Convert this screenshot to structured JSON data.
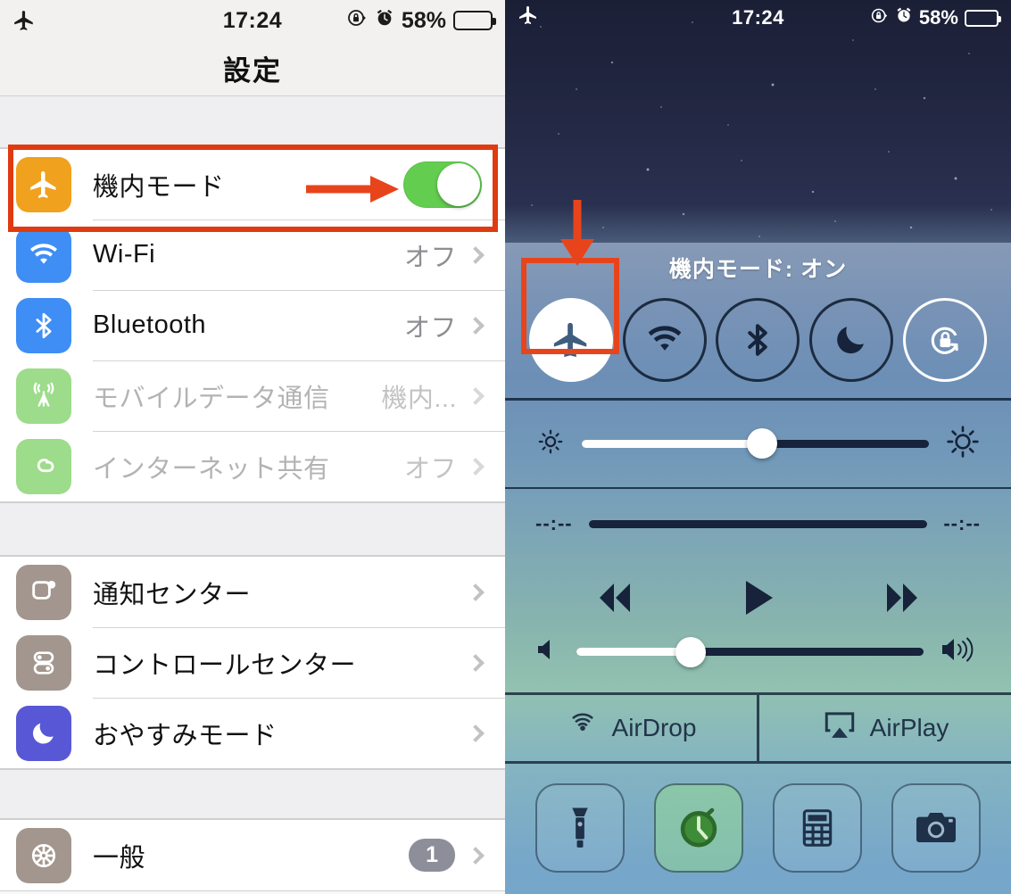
{
  "status_bar": {
    "airplane_icon": "airplane-icon",
    "time": "17:24",
    "rotation_lock_icon": "rotation-lock-icon",
    "alarm_icon": "alarm-icon",
    "battery_percent": "58%",
    "battery_level": 58
  },
  "settings": {
    "nav_title": "設定",
    "group1": [
      {
        "icon": "airplane-icon",
        "label": "機内モード",
        "control": "toggle",
        "toggle_on": true,
        "dim": false
      },
      {
        "icon": "wifi-icon",
        "label": "Wi-Fi",
        "value": "オフ",
        "control": "chevron",
        "dim": false
      },
      {
        "icon": "bluetooth-icon",
        "label": "Bluetooth",
        "value": "オフ",
        "control": "chevron",
        "dim": false
      },
      {
        "icon": "cellular-icon",
        "label": "モバイルデータ通信",
        "value": "機内...",
        "control": "chevron",
        "dim": true
      },
      {
        "icon": "tethering-icon",
        "label": "インターネット共有",
        "value": "オフ",
        "control": "chevron",
        "dim": true
      }
    ],
    "group2": [
      {
        "icon": "notification-center-icon",
        "label": "通知センター",
        "value": "",
        "control": "chevron",
        "dim": false
      },
      {
        "icon": "control-center-icon",
        "label": "コントロールセンター",
        "value": "",
        "control": "chevron",
        "dim": false
      },
      {
        "icon": "do-not-disturb-icon",
        "label": "おやすみモード",
        "value": "",
        "control": "chevron",
        "dim": false
      }
    ],
    "group3": [
      {
        "icon": "general-gear-icon",
        "label": "一般",
        "badge": "1",
        "control": "chevron",
        "dim": false
      }
    ]
  },
  "control_center": {
    "title": "機内モード: オン",
    "toggles": [
      {
        "name": "airplane-mode-toggle",
        "icon": "airplane-icon",
        "active": true
      },
      {
        "name": "wifi-toggle",
        "icon": "wifi-icon",
        "active": false
      },
      {
        "name": "bluetooth-toggle",
        "icon": "bluetooth-icon",
        "active": false
      },
      {
        "name": "do-not-disturb-toggle",
        "icon": "moon-icon",
        "active": false
      },
      {
        "name": "rotation-lock-toggle",
        "icon": "rotation-lock-icon",
        "active": false
      }
    ],
    "brightness": {
      "value_percent": 52,
      "low_icon": "brightness-low-icon",
      "high_icon": "brightness-high-icon"
    },
    "scrubber": {
      "elapsed": "--:--",
      "remaining": "--:--",
      "value_percent": 0
    },
    "media": {
      "rewind": "rewind-icon",
      "play": "play-icon",
      "forward": "forward-icon"
    },
    "volume": {
      "value_percent": 33,
      "low_icon": "volume-low-icon",
      "high_icon": "volume-high-icon"
    },
    "airdrop_label": "AirDrop",
    "airplay_label": "AirPlay",
    "shortcuts": [
      {
        "name": "flashlight-shortcut",
        "icon": "flashlight-icon",
        "active": false
      },
      {
        "name": "timer-shortcut",
        "icon": "timer-icon",
        "active": true
      },
      {
        "name": "calculator-shortcut",
        "icon": "calculator-icon",
        "active": false
      },
      {
        "name": "camera-shortcut",
        "icon": "camera-icon",
        "active": false
      }
    ]
  },
  "annotations": {
    "highlight_color": "#e03a10",
    "left_box_target": "機内モード",
    "left_arrow": "points-right-to-toggle",
    "right_box_target": "airplane-mode-toggle",
    "right_arrow": "points-down-to-toggle"
  }
}
